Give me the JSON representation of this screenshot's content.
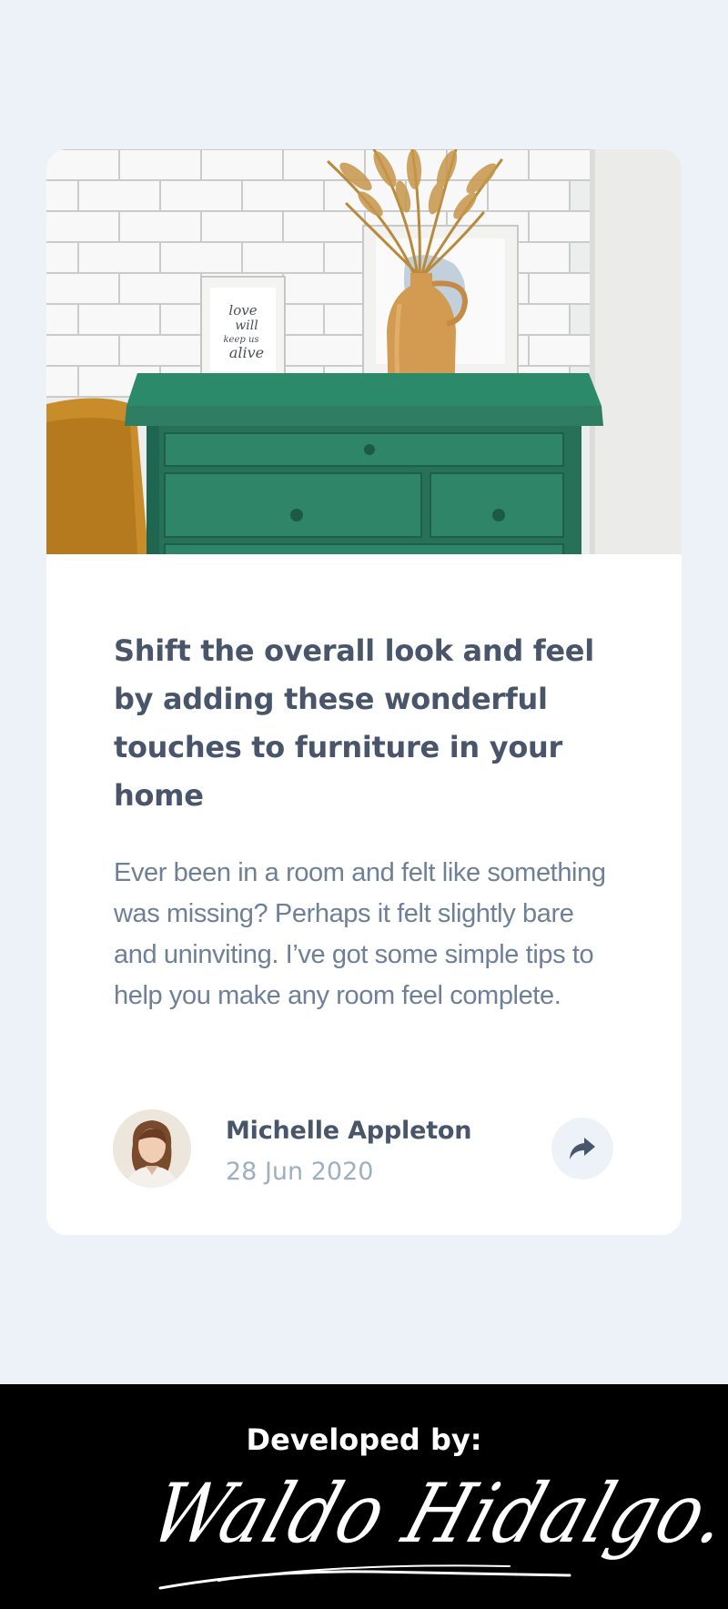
{
  "article": {
    "title": "Shift the overall look and feel by adding these wonderful touches to furniture in your home",
    "description": "Ever been in a room and felt like something was missing? Perhaps it felt slightly bare and uninviting. I’ve got some simple tips to help you make any room feel complete."
  },
  "hero": {
    "frame_text": [
      "love",
      "will",
      "keep us",
      "alive"
    ]
  },
  "author": {
    "name": "Michelle Appleton",
    "date": "28 Jun 2020"
  },
  "share": {
    "icon": "share-icon"
  },
  "footer": {
    "developed_by_label": "Developed by:",
    "signature": "Waldo Hidalgo."
  },
  "colors": {
    "background": "#ecf2f8",
    "card": "#ffffff",
    "title": "#48556a",
    "text": "#6e8098",
    "muted": "#9eafc2",
    "footer": "#000000"
  }
}
